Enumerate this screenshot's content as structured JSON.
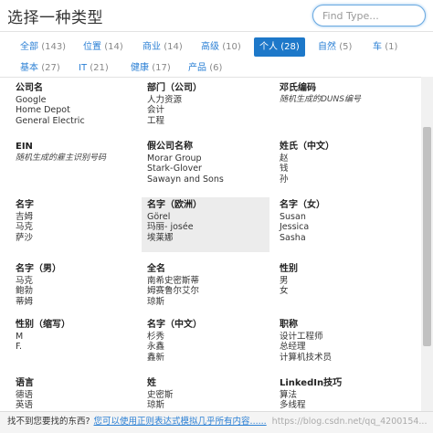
{
  "header": {
    "title": "选择一种类型",
    "search_placeholder": "Find Type..."
  },
  "filters": [
    {
      "label": "全部",
      "count": "(143)",
      "active": false
    },
    {
      "label": "位置",
      "count": "(14)",
      "active": false
    },
    {
      "label": "商业",
      "count": "(14)",
      "active": false
    },
    {
      "label": "高级",
      "count": "(10)",
      "active": false
    },
    {
      "label": "个人",
      "count": "(28)",
      "active": true
    },
    {
      "label": "自然",
      "count": "(5)",
      "active": false
    },
    {
      "label": "车",
      "count": "(1)",
      "active": false
    },
    {
      "label": "基本",
      "count": "(27)",
      "active": false
    },
    {
      "label": "IT",
      "count": "(21)",
      "active": false
    },
    {
      "label": "健康",
      "count": "(17)",
      "active": false
    },
    {
      "label": "产品",
      "count": "(6)",
      "active": false
    }
  ],
  "cards": [
    {
      "title": "公司名",
      "lines": [
        "Google",
        "Home Depot",
        "General Electric"
      ],
      "italic": false,
      "highlighted": false
    },
    {
      "title": "部门（公司）",
      "lines": [
        "人力资源",
        "会计",
        "工程"
      ],
      "italic": false,
      "highlighted": false
    },
    {
      "title": "邓氏编码",
      "lines": [
        "随机生成的DUNS编号"
      ],
      "italic": true,
      "highlighted": false
    },
    {
      "title": "EIN",
      "lines": [
        "随机生成的雇主识别号码"
      ],
      "italic": true,
      "highlighted": false
    },
    {
      "title": "假公司名称",
      "lines": [
        "Morar Group",
        "Stark-Glover",
        "Sawayn and Sons"
      ],
      "italic": false,
      "highlighted": false
    },
    {
      "title": "姓氏（中文）",
      "lines": [
        "赵",
        "钱",
        "孙"
      ],
      "italic": false,
      "highlighted": false
    },
    {
      "title": "名字",
      "lines": [
        "吉姆",
        "马克",
        "萨沙"
      ],
      "italic": false,
      "highlighted": false
    },
    {
      "title": "名字（欧洲）",
      "lines": [
        "Görel",
        "玛丽- josée",
        "埃莱娜"
      ],
      "italic": false,
      "highlighted": true
    },
    {
      "title": "名字（女）",
      "lines": [
        "Susan",
        "Jessica",
        "Sasha"
      ],
      "italic": false,
      "highlighted": false
    },
    {
      "title": "名字（男）",
      "lines": [
        "马克",
        "鲍勃",
        "蒂姆"
      ],
      "italic": false,
      "highlighted": false
    },
    {
      "title": "全名",
      "lines": [
        "南希史密斯蒂",
        "姆赛鲁尔艾尔",
        "琼斯"
      ],
      "italic": false,
      "highlighted": false
    },
    {
      "title": "性别",
      "lines": [
        "男",
        "女"
      ],
      "italic": false,
      "highlighted": false
    },
    {
      "title": "性别（缩写）",
      "lines": [
        "M",
        "F."
      ],
      "italic": false,
      "highlighted": false
    },
    {
      "title": "名字（中文）",
      "lines": [
        "杉秀",
        "永鑫",
        "鑫新"
      ],
      "italic": false,
      "highlighted": false
    },
    {
      "title": "职称",
      "lines": [
        "设计工程师",
        "总经理",
        "计算机技术员"
      ],
      "italic": false,
      "highlighted": false
    },
    {
      "title": "语言",
      "lines": [
        "德语",
        "英语"
      ],
      "italic": false,
      "highlighted": false
    },
    {
      "title": "姓",
      "lines": [
        "史密斯",
        "琼斯"
      ],
      "italic": false,
      "highlighted": false
    },
    {
      "title": "LinkedIn技巧",
      "lines": [
        "算法",
        "多线程"
      ],
      "italic": false,
      "highlighted": false
    }
  ],
  "footer": {
    "question": "找不到您要找的东西?",
    "link": "您可以使用正则表达式模拟几乎所有内容......",
    "watermark": "https://blog.csdn.net/qq_4200154..."
  }
}
